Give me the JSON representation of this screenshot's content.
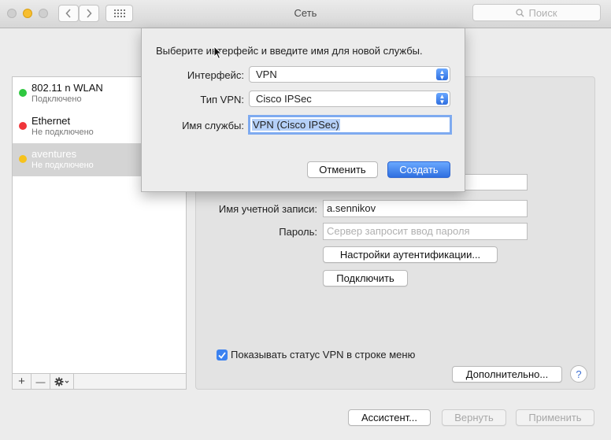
{
  "window": {
    "title": "Сеть",
    "search_placeholder": "Поиск"
  },
  "services": [
    {
      "name": "802.11 n WLAN",
      "status": "Подключено",
      "color": "#2fc840"
    },
    {
      "name": "Ethernet",
      "status": "Не подключено",
      "color": "#f0353a"
    },
    {
      "name": "aventures",
      "status": "Не подключено",
      "color": "#f6c21c"
    }
  ],
  "list_toolbar": {
    "add": "+",
    "remove": "—"
  },
  "vpn_panel": {
    "account_label": "Имя учетной записи:",
    "account_value": "a.sennikov",
    "password_label": "Пароль:",
    "password_placeholder": "Сервер запросит ввод пароля",
    "auth_button": "Настройки аутентификации...",
    "connect_button": "Подключить",
    "show_status_label": "Показывать статус VPN в строке меню",
    "advanced_button": "Дополнительно...",
    "help": "?"
  },
  "footer": {
    "assistant": "Ассистент...",
    "revert": "Вернуть",
    "apply": "Применить"
  },
  "sheet": {
    "prompt": "Выберите интерфейс и введите имя для новой службы.",
    "interface_label": "Интерфейс:",
    "interface_value": "VPN",
    "vpn_type_label": "Тип VPN:",
    "vpn_type_value": "Cisco IPSec",
    "service_name_label": "Имя службы:",
    "service_name_value": "VPN (Cisco IPSec)",
    "cancel": "Отменить",
    "create": "Создать"
  }
}
